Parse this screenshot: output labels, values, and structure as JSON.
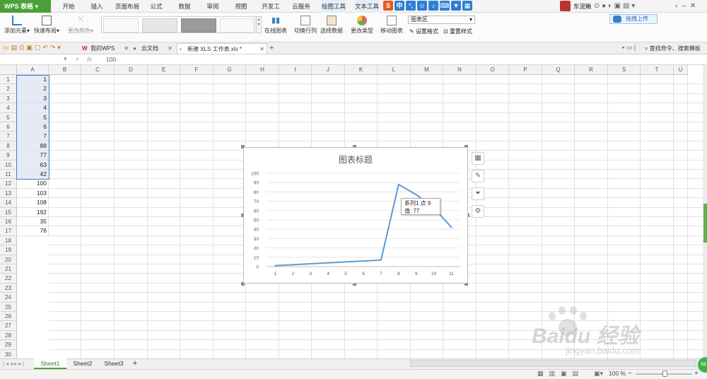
{
  "app": {
    "title": "WPS 表格"
  },
  "menu": [
    "开始",
    "插入",
    "页面布局",
    "公式",
    "数据",
    "审阅",
    "视图",
    "开发工具",
    "云服务",
    "绘图工具",
    "文本工具"
  ],
  "user": {
    "name": "东泥鳅"
  },
  "ime_icons": [
    "S",
    "中",
    "°,",
    "☺",
    "mic-icon",
    "keyboard-icon",
    "shirt-icon",
    "grid-icon"
  ],
  "ribbon": {
    "add_element": "添加元素",
    "quick_layout": "快速布局",
    "change_color": "更改颜色",
    "online_chart": "在线图表",
    "switch_rowcol": "切换行列",
    "select_data": "选择数据",
    "change_type": "更改类型",
    "move_chart": "移动图表",
    "chart_area_select": "图表区",
    "set_format": "设置格式",
    "reset_style": "重置样式",
    "upload": "拖拽上传"
  },
  "tabs": {
    "wps": "我的WPS",
    "cloud": "云文档",
    "doc": "新建 XLS 工作表.xls *",
    "add": "+"
  },
  "search": {
    "placeholder": "查找命令、搜索模板"
  },
  "formula": {
    "fx": "fx",
    "value": "100"
  },
  "columns": [
    "A",
    "B",
    "C",
    "D",
    "E",
    "F",
    "G",
    "H",
    "I",
    "J",
    "K",
    "L",
    "M",
    "N",
    "O",
    "P",
    "Q",
    "R",
    "S",
    "T",
    "U"
  ],
  "rows": [
    "1",
    "2",
    "3",
    "4",
    "5",
    "6",
    "7",
    "8",
    "9",
    "10",
    "11",
    "12",
    "13",
    "14",
    "15",
    "16",
    "17",
    "18",
    "19",
    "20",
    "21",
    "22",
    "23",
    "24",
    "25",
    "26",
    "27",
    "28",
    "29",
    "30"
  ],
  "colA": [
    "1",
    "2",
    "3",
    "4",
    "5",
    "6",
    "7",
    "88",
    "77",
    "63",
    "42",
    "100",
    "103",
    "108",
    "192",
    "35",
    "76"
  ],
  "chart_data": {
    "type": "line",
    "title": "图表标题",
    "categories": [
      "1",
      "2",
      "3",
      "4",
      "5",
      "6",
      "7",
      "8",
      "9",
      "10",
      "11"
    ],
    "series": [
      {
        "values": [
          1,
          2,
          3,
          4,
          5,
          6,
          7,
          88,
          77,
          63,
          42
        ]
      }
    ],
    "ylim": [
      0,
      100
    ],
    "yticks": [
      "0",
      "10",
      "20",
      "30",
      "40",
      "50",
      "60",
      "70",
      "80",
      "90",
      "100"
    ],
    "tooltip": {
      "line1": "系列1 点 9",
      "line2": "值: 77"
    },
    "color": "#5b9bd5"
  },
  "sheets": [
    "Sheet1",
    "Sheet2",
    "Sheet3"
  ],
  "status": {
    "zoom": "100 %"
  },
  "watermark": {
    "brand": "Baidu 经验",
    "url": "jingyan.baidu.com"
  }
}
